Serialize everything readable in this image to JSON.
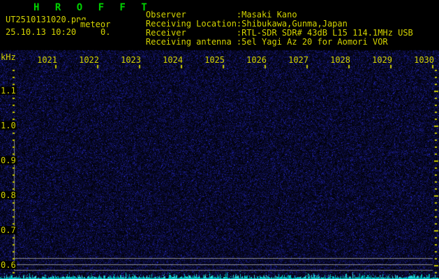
{
  "header": {
    "title": "H R O F F T",
    "filename": "UT2510131020.png",
    "overlay": "meteor",
    "datetime": "25.10.13 10:20",
    "counter": "0.",
    "fields": [
      {
        "label": "Observer",
        "value": ":Masaki Kano"
      },
      {
        "label": "Receiving Location",
        "value": ":Shibukawa,Gunma,Japan"
      },
      {
        "label": "Receiver",
        "value": ":RTL-SDR SDR# 43dB L15 114.1MHz USB"
      },
      {
        "label": "Receiving antenna",
        "value": ":5el Yagi Az 20 for Aomori VOR"
      }
    ]
  },
  "chart_data": {
    "type": "heatmap",
    "description": "HROFFT 10-minute meteor-radio spectrogram filled with faint blue background noise; no meteor echo traces visible. Cyan signal-level trace along the bottom edge.",
    "x_axis": {
      "labels": [
        "1021",
        "1022",
        "1023",
        "1024",
        "1025",
        "1026",
        "1027",
        "1028",
        "1029",
        "1030"
      ]
    },
    "y_axis": {
      "unit": "kHz",
      "labels": [
        "1.1",
        "1.0",
        "0.9",
        "0.8",
        "0.7",
        "0.6"
      ]
    },
    "legend": "none",
    "grid": "off"
  },
  "colors": {
    "background": "#000000",
    "text_yellow": "#d4d400",
    "title_green": "#00d400",
    "tick_yellow": "#c8c800",
    "gray_line": "#8c8c8c",
    "level_cyan": "#00c8c8",
    "noise_blue": "#1a1a66"
  }
}
